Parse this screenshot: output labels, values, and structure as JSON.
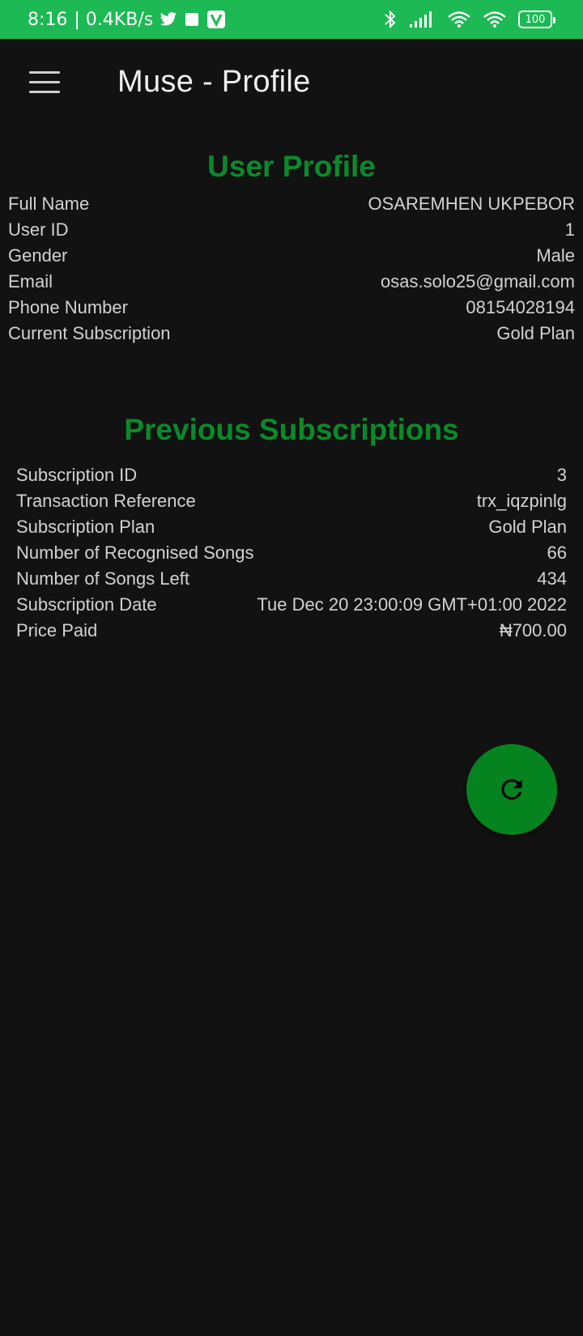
{
  "status_bar": {
    "time": "8:16",
    "speed": "| 0.4KB/s",
    "battery": "100",
    "left_icons": [
      "twitter-icon",
      "square-notification-icon",
      "v-app-icon"
    ],
    "right_icons": [
      "bluetooth-icon",
      "signal-icon",
      "wifi-icon",
      "wifi-icon",
      "battery-icon"
    ]
  },
  "app_bar": {
    "title": "Muse - Profile",
    "menu_icon": "hamburger-menu-icon"
  },
  "user_profile": {
    "title": "User Profile",
    "rows": [
      {
        "label": "Full Name",
        "value": "OSAREMHEN UKPEBOR"
      },
      {
        "label": "User ID",
        "value": "1"
      },
      {
        "label": "Gender",
        "value": "Male"
      },
      {
        "label": "Email",
        "value": "osas.solo25@gmail.com"
      },
      {
        "label": "Phone Number",
        "value": "08154028194"
      },
      {
        "label": "Current Subscription",
        "value": "Gold Plan"
      }
    ]
  },
  "previous_subscriptions": {
    "title": "Previous Subscriptions",
    "rows": [
      {
        "label": "Subscription ID",
        "value": "3"
      },
      {
        "label": "Transaction Reference",
        "value": "trx_iqzpinlg"
      },
      {
        "label": "Subscription Plan",
        "value": "Gold Plan"
      },
      {
        "label": "Number of Recognised Songs",
        "value": "66"
      },
      {
        "label": "Number of Songs Left",
        "value": "434"
      },
      {
        "label": "Subscription Date",
        "value": "Tue Dec 20 23:00:09 GMT+01:00 2022"
      },
      {
        "label": "Price Paid",
        "value": "₦700.00"
      }
    ]
  },
  "fab": {
    "icon": "refresh-icon"
  },
  "colors": {
    "status_bar": "#1db954",
    "accent_green": "#0a8a2a",
    "fab": "#05831f",
    "background": "#121212"
  }
}
